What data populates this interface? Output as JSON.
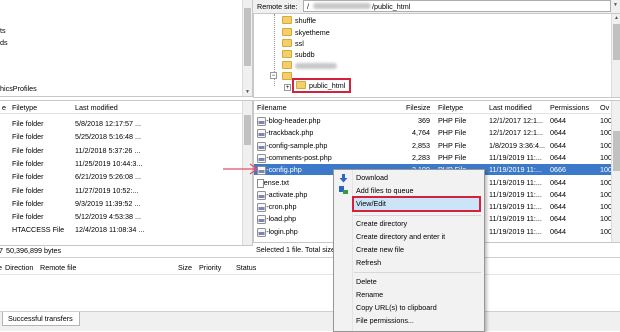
{
  "remote_site": {
    "label": "Remote site:",
    "path_suffix": "/public_html"
  },
  "local_tree_fragments": [
    "ts",
    "ds",
    "hicsProfiles"
  ],
  "remote_tree": {
    "items": [
      "shuffle",
      "skyetheme",
      "ssl",
      "subdb",
      "public_html"
    ],
    "highlight_color": "#d4213d"
  },
  "local_list": {
    "headers": [
      "e",
      "Filetype",
      "Last modified"
    ],
    "rows": [
      {
        "type": "File folder",
        "modified": "5/8/2018 12:17:57 ..."
      },
      {
        "type": "File folder",
        "modified": "5/25/2018 5:16:48 ..."
      },
      {
        "type": "File folder",
        "modified": "11/2/2018 5:37:26 ..."
      },
      {
        "type": "File folder",
        "modified": "11/25/2019 10:44:3..."
      },
      {
        "type": "File folder",
        "modified": "6/21/2019 5:26:08 ..."
      },
      {
        "type": "File folder",
        "modified": "11/27/2019 10:52:..."
      },
      {
        "type": "File folder",
        "modified": "9/3/2019 11:39:52 ..."
      },
      {
        "type": "File folder",
        "modified": "5/12/2019 4:53:38 ..."
      },
      {
        "type": "HTACCESS File",
        "modified": "12/4/2018 11:08:34 ..."
      }
    ],
    "status": "50,396,899 bytes",
    "fragment_7": "7"
  },
  "remote_list": {
    "headers": [
      "Filename",
      "Filesize",
      "Filetype",
      "Last modified",
      "Permissions",
      "Ov"
    ],
    "rows": [
      {
        "name": "wp-blog-header.php",
        "size": "369",
        "type": "PHP File",
        "modified": "12/1/2017 12:1...",
        "perm": "0644",
        "owner": "100"
      },
      {
        "name": "wp-trackback.php",
        "size": "4,764",
        "type": "PHP File",
        "modified": "12/1/2017 12:1...",
        "perm": "0644",
        "owner": "100"
      },
      {
        "name": "wp-config-sample.php",
        "size": "2,853",
        "type": "PHP File",
        "modified": "1/8/2019 3:36:4...",
        "perm": "0644",
        "owner": "100"
      },
      {
        "name": "wp-comments-post.php",
        "size": "2,283",
        "type": "PHP File",
        "modified": "11/19/2019 11:...",
        "perm": "0644",
        "owner": "100"
      },
      {
        "name": "wp-config.php",
        "size": "3,199",
        "type": "PHP File",
        "modified": "11/19/2019 11:...",
        "perm": "0666",
        "owner": "100"
      },
      {
        "name": "license.txt",
        "size": "",
        "type": "",
        "modified": "11/19/2019 11:...",
        "perm": "0644",
        "owner": "100"
      },
      {
        "name": "wp-activate.php",
        "size": "",
        "type": "",
        "modified": "11/19/2019 11:...",
        "perm": "0644",
        "owner": "100"
      },
      {
        "name": "wp-cron.php",
        "size": "",
        "type": "",
        "modified": "11/19/2019 11:...",
        "perm": "0644",
        "owner": "100"
      },
      {
        "name": "wp-load.php",
        "size": "",
        "type": "",
        "modified": "11/19/2019 11:...",
        "perm": "0644",
        "owner": "100"
      },
      {
        "name": "wp-login.php",
        "size": "",
        "type": "",
        "modified": "11/19/2019 11:...",
        "perm": "0644",
        "owner": "100"
      }
    ],
    "status": "Selected 1 file. Total size"
  },
  "queue": {
    "headers": [
      "Direction",
      "Remote file",
      "Size",
      "Priority",
      "Status"
    ],
    "fragment_e": "e"
  },
  "bottom_tab": "Successful transfers",
  "context_menu": {
    "items": [
      {
        "label": "Download",
        "icon": "download-arrow-icon"
      },
      {
        "label": "Add files to queue",
        "icon": "add-to-queue-icon"
      },
      {
        "label": "View/Edit",
        "icon": ""
      },
      {
        "label": "Create directory",
        "icon": ""
      },
      {
        "label": "Create directory and enter it",
        "icon": ""
      },
      {
        "label": "Create new file",
        "icon": ""
      },
      {
        "label": "Refresh",
        "icon": ""
      },
      {
        "label": "Delete",
        "icon": ""
      },
      {
        "label": "Rename",
        "icon": ""
      },
      {
        "label": "Copy URL(s) to clipboard",
        "icon": ""
      },
      {
        "label": "File permissions...",
        "icon": ""
      }
    ],
    "highlight_color": "#d4213d",
    "hover_color": "#cce4f7"
  },
  "colors": {
    "selection": "#3c79c8",
    "arrow": "#e2506a",
    "folder": "#f2cf68"
  }
}
